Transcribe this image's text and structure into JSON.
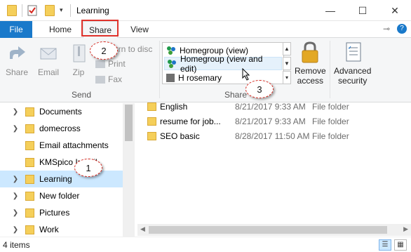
{
  "window": {
    "title": "Learning",
    "controls": {
      "minimize": "—",
      "maximize": "☐",
      "close": "✕"
    }
  },
  "ribbon_tabs": {
    "file": "File",
    "home": "Home",
    "share": "Share",
    "view": "View",
    "pin_icon": "⊸",
    "help_icon": "?"
  },
  "send_group": {
    "share": "Share",
    "email": "Email",
    "zip": "Zip",
    "burn": "Burn to disc",
    "print": "Print",
    "fax": "Fax",
    "label": "Send"
  },
  "share_group": {
    "items": [
      {
        "label": "Homegroup (view)"
      },
      {
        "label": "Homegroup (view and edit)"
      },
      {
        "label": "H rosemary"
      }
    ],
    "remove_access_line1": "Remove",
    "remove_access_line2": "access",
    "advanced_line1": "Advanced",
    "advanced_line2": "security",
    "label": "Share"
  },
  "nav_pane": {
    "items": [
      {
        "label": "Documents"
      },
      {
        "label": "domecross"
      },
      {
        "label": "Email attachments"
      },
      {
        "label": "KMSpico Install"
      },
      {
        "label": "Learning"
      },
      {
        "label": "New folder"
      },
      {
        "label": "Pictures"
      },
      {
        "label": "Work"
      }
    ]
  },
  "files": [
    {
      "name": "English",
      "date": "8/21/2017 9:33 AM",
      "type": "File folder"
    },
    {
      "name": "resume for job...",
      "date": "8/21/2017 9:33 AM",
      "type": "File folder"
    },
    {
      "name": "SEO basic",
      "date": "8/28/2017 11:50 AM",
      "type": "File folder"
    }
  ],
  "status": {
    "count": "4 items"
  },
  "callouts": {
    "c1": "1",
    "c2": "2",
    "c3": "3"
  },
  "colors": {
    "accent": "#1979ca",
    "highlight": "#e0322b",
    "selection": "#cce8ff"
  }
}
